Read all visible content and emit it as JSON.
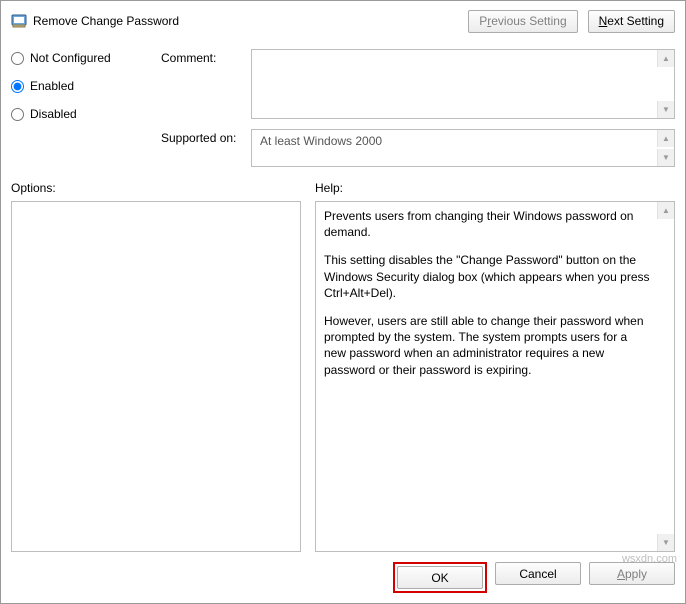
{
  "title": "Remove Change Password",
  "nav": {
    "prev_pre": "P",
    "prev_ul": "r",
    "prev_post": "evious Setting",
    "next_pre": "",
    "next_ul": "N",
    "next_post": "ext Setting"
  },
  "state": {
    "not_configured": "Not Configured",
    "enabled": "Enabled",
    "disabled": "Disabled",
    "selected": "enabled"
  },
  "labels": {
    "comment": "Comment:",
    "supported": "Supported on:",
    "options": "Options:",
    "help": "Help:"
  },
  "supported_on": "At least Windows 2000",
  "help": {
    "p1": "Prevents users from changing their Windows password on demand.",
    "p2": "This setting disables the \"Change Password\" button on the Windows Security dialog box (which appears when you press Ctrl+Alt+Del).",
    "p3": "However, users are still able to change their password when prompted by the system. The system prompts users for a new password when an administrator requires a new password or their password is expiring."
  },
  "buttons": {
    "ok": "OK",
    "cancel": "Cancel",
    "apply": "Apply"
  },
  "watermark": "wsxdn.com"
}
